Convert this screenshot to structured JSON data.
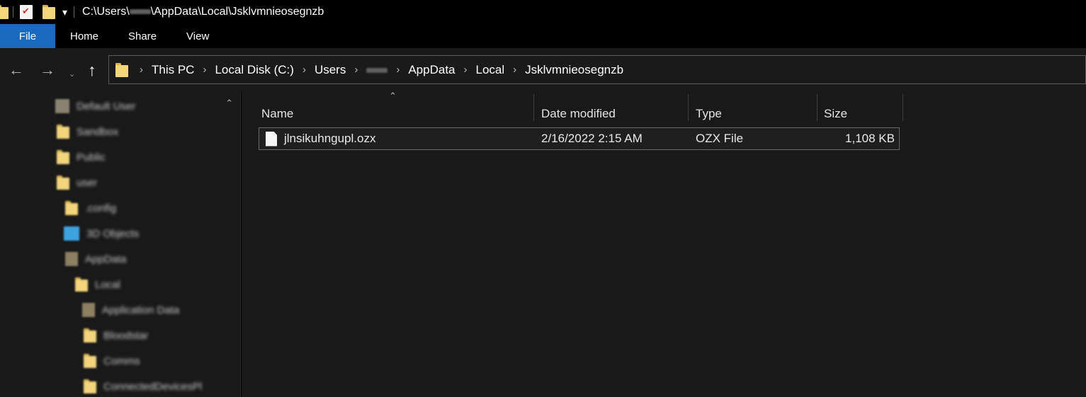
{
  "titlebar": {
    "path_prefix": "C:\\Users\\",
    "path_user": "user",
    "path_suffix": "\\AppData\\Local\\Jsklvmnieosegnzb",
    "icons": [
      "folder-icon",
      "properties-check-icon",
      "new-folder-icon",
      "customize-dropdown-icon"
    ],
    "dropdown_glyph": "▾"
  },
  "ribbon": {
    "tabs": [
      "File",
      "Home",
      "Share",
      "View"
    ],
    "accent": "#1a6ac0"
  },
  "nav": {
    "back_glyph": "←",
    "forward_glyph": "→",
    "recent_glyph": "⌄",
    "up_glyph": "↑"
  },
  "address": {
    "crumbs": [
      "This PC",
      "Local Disk (C:)",
      "Users",
      "user",
      "AppData",
      "Local",
      "Jsklvmnieosegnzb"
    ],
    "separator": "›"
  },
  "navpane": {
    "items": [
      {
        "label": "Default User",
        "icon": "user-folder-icon"
      },
      {
        "label": "Sandbox",
        "icon": "folder-icon"
      },
      {
        "label": "Public",
        "icon": "folder-icon"
      },
      {
        "label": "user",
        "icon": "folder-icon"
      },
      {
        "label": ".config",
        "icon": "folder-icon"
      },
      {
        "label": "3D Objects",
        "icon": "3d-objects-icon"
      },
      {
        "label": "AppData",
        "icon": "folder-icon"
      },
      {
        "label": "Local",
        "icon": "folder-icon"
      },
      {
        "label": "Application Data",
        "icon": "shortcut-folder-icon"
      },
      {
        "label": "Bloodstar",
        "icon": "folder-icon"
      },
      {
        "label": "Comms",
        "icon": "folder-icon"
      },
      {
        "label": "ConnectedDevicesPl",
        "icon": "folder-icon"
      }
    ],
    "scroll_glyph": "⌃"
  },
  "filelist": {
    "sort_glyph": "⌃",
    "columns": {
      "name": "Name",
      "date": "Date modified",
      "type": "Type",
      "size": "Size"
    },
    "rows": [
      {
        "name": "jlnsikuhngupl.ozx",
        "date": "2/16/2022 2:15 AM",
        "type": "OZX File",
        "size": "1,108 KB"
      }
    ]
  }
}
